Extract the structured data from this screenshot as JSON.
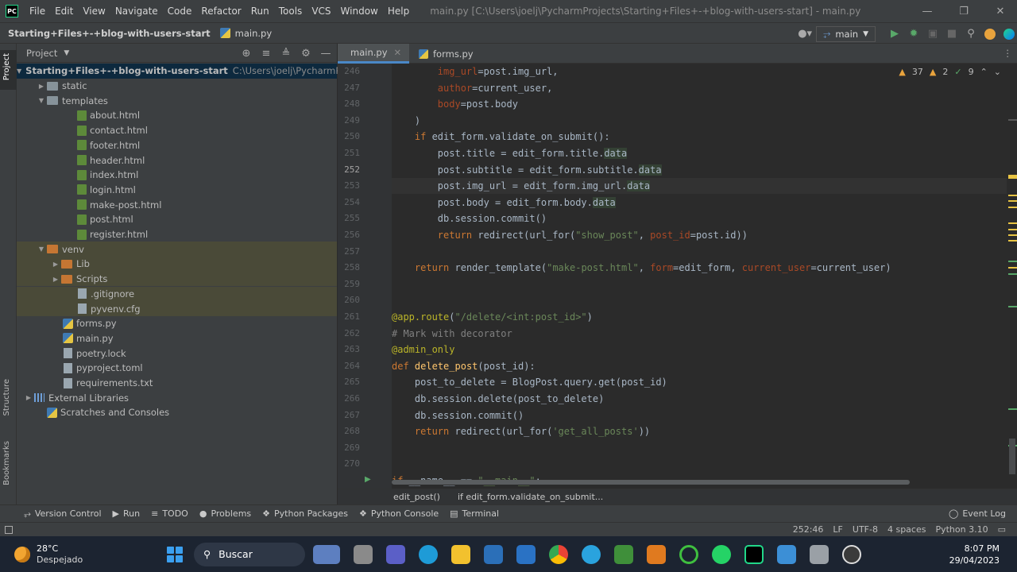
{
  "menu": {
    "items": [
      "File",
      "Edit",
      "View",
      "Navigate",
      "Code",
      "Refactor",
      "Run",
      "Tools",
      "VCS",
      "Window",
      "Help"
    ],
    "window_title": "main.py [C:\\Users\\joelj\\PycharmProjects\\Starting+Files+-+blog-with-users-start] - main.py"
  },
  "navbar": {
    "project": "Starting+Files+-+blog-with-users-start",
    "file": "main.py",
    "branch": "main"
  },
  "stripe": {
    "project": "Project",
    "structure": "Structure",
    "bookmarks": "Bookmarks"
  },
  "project_panel": {
    "title": "Project",
    "tree": [
      {
        "label": "Starting+Files+-+blog-with-users-start",
        "path": "C:\\Users\\joelj\\PycharmProjects",
        "kind": "root"
      },
      {
        "label": "static",
        "kind": "folder"
      },
      {
        "label": "templates",
        "kind": "folder-open"
      },
      {
        "label": "about.html",
        "kind": "html"
      },
      {
        "label": "contact.html",
        "kind": "html"
      },
      {
        "label": "footer.html",
        "kind": "html"
      },
      {
        "label": "header.html",
        "kind": "html"
      },
      {
        "label": "index.html",
        "kind": "html"
      },
      {
        "label": "login.html",
        "kind": "html"
      },
      {
        "label": "make-post.html",
        "kind": "html"
      },
      {
        "label": "post.html",
        "kind": "html"
      },
      {
        "label": "register.html",
        "kind": "html"
      },
      {
        "label": "venv",
        "kind": "venv"
      },
      {
        "label": "Lib",
        "kind": "vfolder"
      },
      {
        "label": "Scripts",
        "kind": "vfolder"
      },
      {
        "label": ".gitignore",
        "kind": "vfile"
      },
      {
        "label": "pyvenv.cfg",
        "kind": "vfile"
      },
      {
        "label": "forms.py",
        "kind": "py"
      },
      {
        "label": "main.py",
        "kind": "py"
      },
      {
        "label": "poetry.lock",
        "kind": "txt"
      },
      {
        "label": "pyproject.toml",
        "kind": "txt"
      },
      {
        "label": "requirements.txt",
        "kind": "txt"
      },
      {
        "label": "External Libraries",
        "kind": "lib"
      },
      {
        "label": "Scratches and Consoles",
        "kind": "scratch"
      }
    ]
  },
  "editor": {
    "tabs": [
      "main.py",
      "forms.py"
    ],
    "inspections": {
      "warnings": "37",
      "weak": "2",
      "typos": "9"
    },
    "line_numbers": [
      "246",
      "247",
      "248",
      "249",
      "250",
      "251",
      "252",
      "253",
      "254",
      "255",
      "256",
      "257",
      "258",
      "259",
      "260",
      "261",
      "262",
      "263",
      "264",
      "265",
      "266",
      "267",
      "268",
      "269",
      "270"
    ],
    "current_line": "252",
    "breadcrumb": [
      "edit_post()",
      "if edit_form.validate_on_submit..."
    ]
  },
  "toolwindows": [
    "Version Control",
    "Run",
    "TODO",
    "Problems",
    "Python Packages",
    "Python Console",
    "Terminal"
  ],
  "event_log": "Event Log",
  "status": {
    "position": "252:46",
    "line_sep": "LF",
    "encoding": "UTF-8",
    "indent": "4 spaces",
    "interpreter": "Python 3.10"
  },
  "taskbar": {
    "temp": "28°C",
    "weather": "Despejado",
    "search": "Buscar",
    "time": "8:07 PM",
    "date": "29/04/2023"
  },
  "colors": {
    "accent": "#4a88c7",
    "keyword": "#cc7832",
    "string": "#6a8759",
    "function": "#ffc66d"
  }
}
